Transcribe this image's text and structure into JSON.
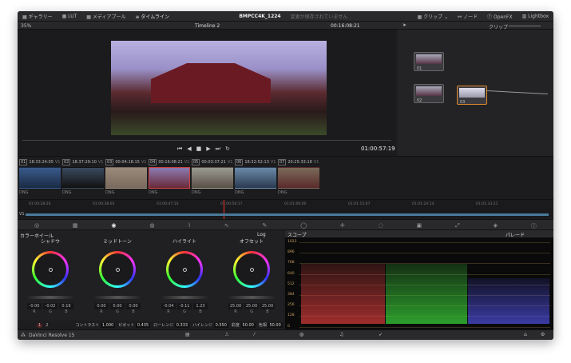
{
  "topbar": {
    "gallery": "ギャラリー",
    "lut": "LUT",
    "media_pool": "メディアプール",
    "timeline": "タイムライン",
    "project": "BMPCC4K_1224",
    "unsaved": "変更が保存されていません",
    "clips": "クリップ",
    "nodes": "ノード",
    "openfx": "OpenFX",
    "lightbox": "Lightbox"
  },
  "viewer": {
    "zoom": "35%",
    "timeline_name": "Timeline 2",
    "timecode": "00:16:08:21",
    "playhead_tc": "01:00:57:19"
  },
  "node_editor": {
    "mode": "クリップ",
    "nodes": [
      {
        "label": "01"
      },
      {
        "label": "02"
      },
      {
        "label": "03"
      }
    ]
  },
  "clips": [
    {
      "num": "01",
      "tc": "18:33:24:05",
      "track": "V1",
      "fmt": "DNG",
      "c1": "#3a5a8a",
      "c2": "#1a2a44"
    },
    {
      "num": "02",
      "tc": "18:37:29:10",
      "track": "V1",
      "fmt": "DNG",
      "c1": "#3a4a5e",
      "c2": "#111"
    },
    {
      "num": "03",
      "tc": "00:04:18:15",
      "track": "V1",
      "fmt": "DNG",
      "c1": "#9a8a7a",
      "c2": "#7a6a5e"
    },
    {
      "num": "04",
      "tc": "00:16:08:21",
      "track": "V1",
      "fmt": "DNG",
      "c1": "#8a7ab0",
      "c2": "#6a2a3a"
    },
    {
      "num": "05",
      "tc": "00:03:37:21",
      "track": "V1",
      "fmt": "DNG",
      "c1": "#9a9a90",
      "c2": "#5a5048"
    },
    {
      "num": "06",
      "tc": "18:32:52:13",
      "track": "V1",
      "fmt": "DNG",
      "c1": "#6a8aa8",
      "c2": "#2a3a50"
    },
    {
      "num": "07",
      "tc": "20:25:33:18",
      "track": "V1",
      "fmt": "DNG",
      "c1": "#7a6a5a",
      "c2": "#5a2a2a"
    }
  ],
  "timeline_ruler": [
    "01:00:28:20",
    "01:00:38:03",
    "01:00:47:10",
    "01:00:56:17",
    "01:01:06:00",
    "01:01:15:07",
    "01:01:24:14",
    "01:01:33:21"
  ],
  "track_label": "V1",
  "color_wheels": {
    "title": "カラーホイール",
    "mode": "Log",
    "wheels": [
      {
        "name": "シャドウ",
        "r": "-0.00",
        "g": "-0.02",
        "b": "0.19"
      },
      {
        "name": "ミッドトーン",
        "r": "0.00",
        "g": "0.00",
        "b": "0.00"
      },
      {
        "name": "ハイライト",
        "r": "-0.04",
        "g": "-0.11",
        "b": "1.23"
      },
      {
        "name": "オフセット",
        "r": "25.00",
        "g": "25.00",
        "b": "25.00"
      }
    ],
    "channel_labels": [
      "R",
      "G",
      "B"
    ],
    "pages": [
      "1",
      "2"
    ],
    "adjust": [
      {
        "label": "コントラスト",
        "value": "1.000"
      },
      {
        "label": "ピボット",
        "value": "0.435"
      },
      {
        "label": "ローレンジ",
        "value": "0.333"
      },
      {
        "label": "ハイレンジ",
        "value": "0.550"
      },
      {
        "label": "彩度",
        "value": "50.00"
      },
      {
        "label": "色相",
        "value": "50.00"
      }
    ]
  },
  "scope": {
    "title": "スコープ",
    "mode": "パレード",
    "ticks": [
      "1023",
      "896",
      "768",
      "640",
      "512",
      "384",
      "256",
      "128",
      "0"
    ]
  },
  "bottom": {
    "app": "DaVinci Resolve 15"
  }
}
